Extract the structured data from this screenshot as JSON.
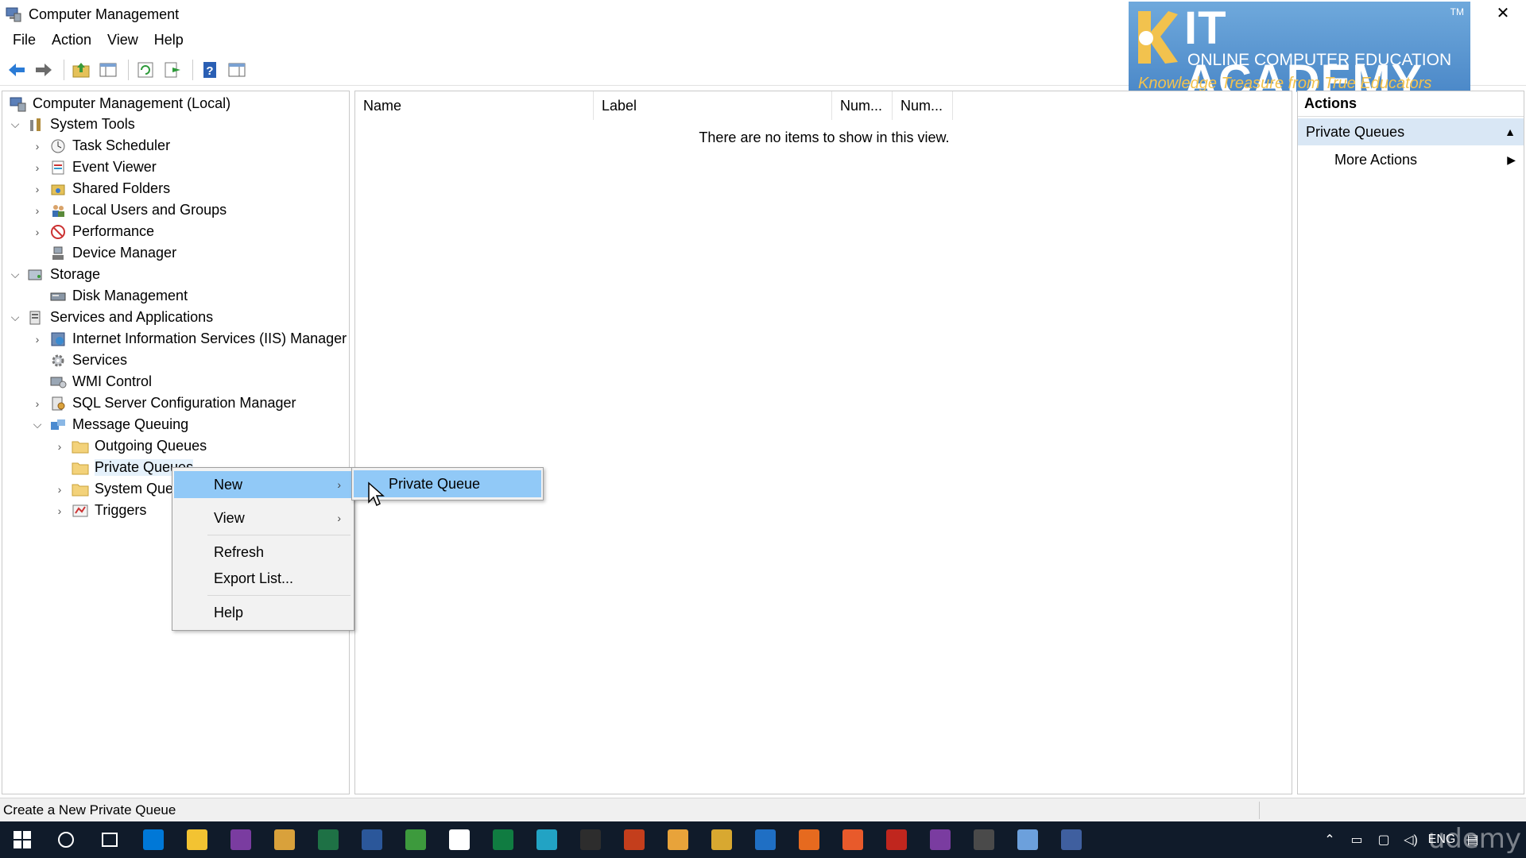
{
  "window": {
    "title": "Computer Management",
    "minimize": "—",
    "restore": "❐",
    "close": "✕"
  },
  "menubar": [
    "File",
    "Action",
    "View",
    "Help"
  ],
  "toolbar": {
    "icons": [
      "back-arrow-icon",
      "forward-arrow-icon",
      "up-folder-icon",
      "show-hide-tree-icon",
      "refresh-icon",
      "export-list-icon",
      "help-icon",
      "console-view-icon"
    ]
  },
  "logo": {
    "line1": "IT ACADEMY",
    "line2": "ONLINE COMPUTER EDUCATION",
    "line3": "Knowledge Treasure from True Educators",
    "tm": "TM"
  },
  "tree": {
    "root": "Computer Management (Local)",
    "items": [
      {
        "label": "System Tools"
      },
      {
        "label": "Task Scheduler"
      },
      {
        "label": "Event Viewer"
      },
      {
        "label": "Shared Folders"
      },
      {
        "label": "Local Users and Groups"
      },
      {
        "label": "Performance"
      },
      {
        "label": "Device Manager"
      },
      {
        "label": "Storage"
      },
      {
        "label": "Disk Management"
      },
      {
        "label": "Services and Applications"
      },
      {
        "label": "Internet Information Services (IIS) Manager"
      },
      {
        "label": "Services"
      },
      {
        "label": "WMI Control"
      },
      {
        "label": "SQL Server Configuration Manager"
      },
      {
        "label": "Message Queuing"
      },
      {
        "label": "Outgoing Queues"
      },
      {
        "label": "Private Queues"
      },
      {
        "label": "System Queues"
      },
      {
        "label": "Triggers"
      }
    ]
  },
  "list": {
    "columns": [
      "Name",
      "Label",
      "Num...",
      "Num..."
    ],
    "empty_message": "There are no items to show in this view."
  },
  "actions": {
    "header": "Actions",
    "section": "Private Queues",
    "items": [
      "More Actions"
    ]
  },
  "context_menu": {
    "items": [
      "New",
      "View",
      "Refresh",
      "Export List...",
      "Help"
    ],
    "submenu": [
      "Private Queue"
    ]
  },
  "status": {
    "text": "Create a New Private Queue"
  },
  "taskbar": {
    "language": "ENG",
    "watermark": "udemy",
    "colors": [
      "#0078d7",
      "#f3c332",
      "#7a3ca0",
      "#d9a13b",
      "#1e7145",
      "#2b579a",
      "#3d9a3d",
      "#ffffff",
      "#107c41",
      "#22a3c4",
      "#2d2d2d",
      "#c43e1c",
      "#e8a33a",
      "#d8a830",
      "#1f6fc4",
      "#e66a1f",
      "#e85a2b",
      "#c0261e",
      "#7a3ca0",
      "#4a4a4a",
      "#6ca0dc",
      "#3f5f9f"
    ]
  }
}
